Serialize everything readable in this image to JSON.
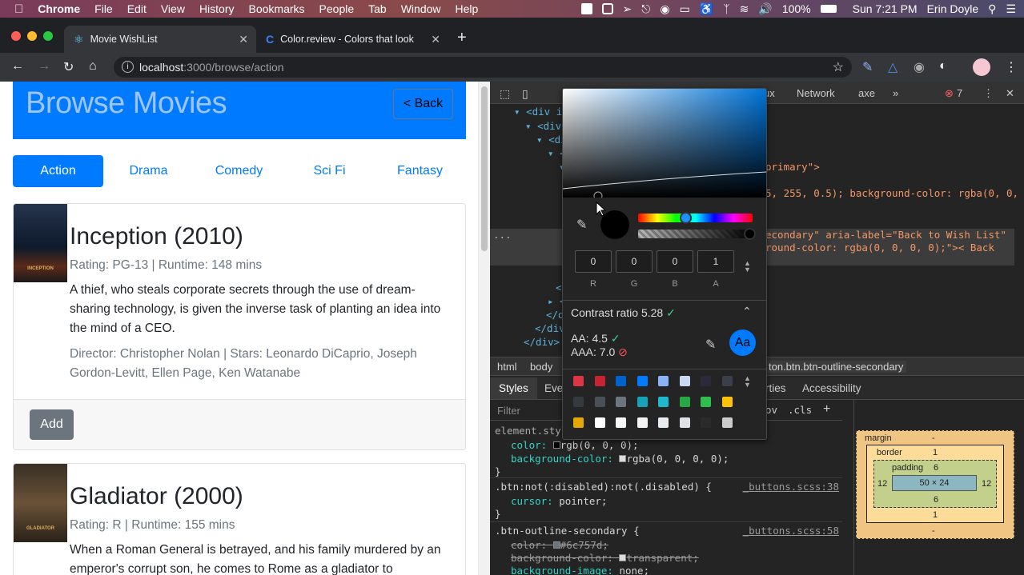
{
  "menubar": {
    "app_name": "Chrome",
    "items": [
      "File",
      "Edit",
      "View",
      "History",
      "Bookmarks",
      "People",
      "Tab",
      "Window",
      "Help"
    ],
    "battery": "100%",
    "clock": "Sun 7:21 PM",
    "user": "Erin Doyle"
  },
  "browser": {
    "tabs": [
      {
        "title": "Movie WishList"
      },
      {
        "title": "Color.review - Colors that look"
      }
    ],
    "url_host": "localhost",
    "url_path": ":3000/browse/action"
  },
  "page": {
    "title": "Browse Movies",
    "back_label": "< Back",
    "genres": [
      "Action",
      "Drama",
      "Comedy",
      "Sci Fi",
      "Fantasy"
    ],
    "active_genre": "Action",
    "movies": [
      {
        "poster_text": "INCEPTION",
        "title": "Inception (2010)",
        "meta": "Rating: PG-13 | Runtime: 148 mins",
        "description": "A thief, who steals corporate secrets through the use of dream-sharing technology, is given the inverse task of planting an idea into the mind of a CEO.",
        "people": "Director: Christopher Nolan | Stars: Leonardo DiCaprio, Joseph Gordon-Levitt, Ellen Page, Ken Watanabe",
        "add_label": "Add"
      },
      {
        "poster_text": "GLADIATOR",
        "title": "Gladiator (2000)",
        "meta": "Rating: R | Runtime: 155 mins",
        "description": "When a Roman General is betrayed, and his family murdered by an emperor's corrupt son, he comes to Rome as a gladiator to"
      }
    ]
  },
  "devtools": {
    "tabs": [
      "ux",
      "Network",
      "axe"
    ],
    "error_count": "7",
    "breadcrumbs": [
      "html",
      "body",
      "ton.btn.btn-outline-secondary"
    ],
    "subtabs": [
      "Styles",
      "Eve",
      "rties",
      "Accessibility"
    ],
    "filter_placeholder": "Filter",
    "filter_tools": [
      "ov",
      ".cls",
      "+"
    ],
    "code_lines": {
      "l1": "<div ic",
      "l2": "<div",
      "l3": "<di",
      "l4": "<",
      "l5": "primary\">",
      "l6": "5, 255, 0.5); background-color: rgba(0, 0,",
      "l7": "econdary\" aria-label=\"Back to Wish List\"",
      "l8": "round-color: rgba(0, 0, 0, 0);\">< Back",
      "l9": "</div>",
      "l10": "</div>",
      "l11": "</div>",
      "ellipsis": "..."
    },
    "styles": {
      "element_style": "element.styl",
      "color_prop": "color:",
      "color_val": "rgb(0, 0, 0);",
      "bg_prop": "background-color:",
      "bg_val": "rgba(0, 0, 0, 0);",
      "rule2_selector": ".btn:not(:disabled):not(.disabled) {",
      "rule2_src": "_buttons.scss:38",
      "rule2_prop": "cursor:",
      "rule2_val": "pointer;",
      "rule3_selector": ".btn-outline-secondary {",
      "rule3_src": "_buttons.scss:58",
      "rule3_color": "color:",
      "rule3_color_val": "#6c757d;",
      "rule3_bg": "background-color:",
      "rule3_bg_val": "transparent;",
      "rule3_bgimg": "background-image:",
      "rule3_bgimg_val": "none;",
      "close_brace": "}"
    },
    "box_model": {
      "margin_label": "margin",
      "margin_top": "-",
      "margin_bottom": "-",
      "margin_left": "1",
      "margin_right": "1",
      "border_label": "border",
      "border_top": "1",
      "border_bottom": "1",
      "padding_label": "padding",
      "padding_top": "6",
      "padding_bottom": "6",
      "padding_left": "12",
      "padding_right": "12",
      "content": "50 × 24"
    }
  },
  "color_picker": {
    "r": "0",
    "g": "0",
    "b": "0",
    "a": "1",
    "labels": [
      "R",
      "G",
      "B",
      "A"
    ],
    "contrast_label": "Contrast ratio",
    "contrast_value": "5.28",
    "aa_label": "AA: 4.5",
    "aaa_label": "AAA: 7.0",
    "sample_text": "Aa",
    "swatch_colors": [
      "#dc3545",
      "#c82333",
      "#0062cc",
      "#007bff",
      "#8ab4f8",
      "#c9d9f5",
      "#2a2a3a",
      "#3a3f48",
      "#343a40",
      "#495057",
      "#6c757d",
      "#17a2b8",
      "#1fb7d0",
      "#28a745",
      "#2ebf4f",
      "#ffc107",
      "#e0a800",
      "#ffffff",
      "#f8f9fa",
      "#f1f3f5",
      "#e9ecef",
      "#dee2e6",
      "#2b2b2b",
      "#cccccc"
    ]
  },
  "colors": {
    "primary": "#007bff",
    "secondary": "#6c757d"
  }
}
